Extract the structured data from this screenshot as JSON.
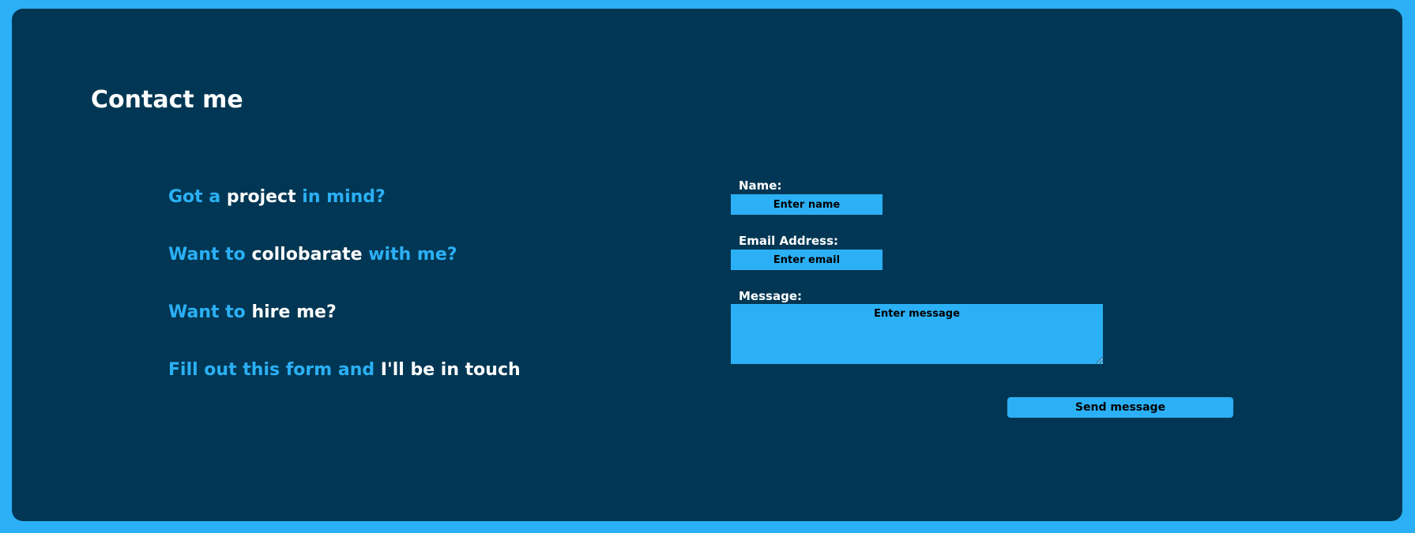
{
  "page": {
    "title": "Contact me"
  },
  "pitch": {
    "line1": {
      "a": "Got a",
      "b": "project",
      "c": "in mind?"
    },
    "line2": {
      "a": "Want to",
      "b": "collobarate",
      "c": "with me?"
    },
    "line3": {
      "a": "Want to",
      "b": "hire me?"
    },
    "line4": {
      "a": "Fill out this form and",
      "b": "I'll be in touch"
    }
  },
  "form": {
    "name_label": "Name:",
    "name_placeholder": "Enter name",
    "email_label": "Email Address:",
    "email_placeholder": "Enter email",
    "message_label": "Message:",
    "message_placeholder": "Enter message",
    "send_label": "Send message"
  },
  "colors": {
    "background": "#2bb0f5",
    "panel": "#013754",
    "accent": "#2bb0f5",
    "text": "#ffffff"
  }
}
